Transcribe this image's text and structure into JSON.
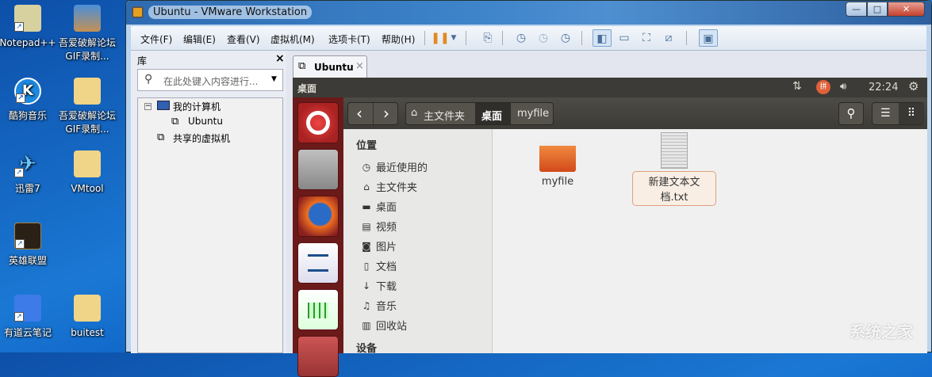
{
  "desktop": {
    "icons": [
      {
        "label": "Notepad++",
        "icon": "notepad-icon"
      },
      {
        "label": "吾爱破解论坛GIF录制...",
        "icon": "archive-icon"
      },
      {
        "label": "酷狗音乐",
        "icon": "kugou-icon"
      },
      {
        "label": "吾爱破解论坛GIF录制...",
        "icon": "folder-icon"
      },
      {
        "label": "迅雷7",
        "icon": "xunlei-icon"
      },
      {
        "label": "VMtool",
        "icon": "folder-icon"
      },
      {
        "label": "英雄联盟",
        "icon": "lol-icon"
      },
      {
        "label": "有道云笔记",
        "icon": "youdao-icon"
      },
      {
        "label": "buitest",
        "icon": "folder-icon"
      }
    ]
  },
  "window": {
    "title": "Ubuntu - VMware Workstation",
    "min": "—",
    "max": "□",
    "close": "✕"
  },
  "menu": [
    "文件(F)",
    "编辑(E)",
    "查看(V)",
    "虚拟机(M)",
    "选项卡(T)",
    "帮助(H)"
  ],
  "library": {
    "title": "库",
    "close": "×",
    "search_placeholder": "在此处键入内容进行...",
    "tree": {
      "root": "我的计算机",
      "child": "Ubuntu",
      "shared": "共享的虚拟机"
    }
  },
  "tab": {
    "label": "Ubuntu",
    "close": "×"
  },
  "ubuntu": {
    "panel_title": "桌面",
    "time": "22:24",
    "breadcrumb": [
      "主文件夹",
      "桌面",
      "myfile"
    ],
    "nav": {
      "back": "‹",
      "forward": "›"
    },
    "sidebar": {
      "places_header": "位置",
      "items": [
        {
          "label": "最近使用的",
          "icon": "clock-icon",
          "glyph": "◷"
        },
        {
          "label": "主文件夹",
          "icon": "home-icon",
          "glyph": "⌂"
        },
        {
          "label": "桌面",
          "icon": "folder-icon",
          "glyph": "▬"
        },
        {
          "label": "视频",
          "icon": "film-icon",
          "glyph": "▤"
        },
        {
          "label": "图片",
          "icon": "camera-icon",
          "glyph": "◙"
        },
        {
          "label": "文档",
          "icon": "document-icon",
          "glyph": "▯"
        },
        {
          "label": "下载",
          "icon": "download-icon",
          "glyph": "↓"
        },
        {
          "label": "音乐",
          "icon": "music-icon",
          "glyph": "♫"
        },
        {
          "label": "回收站",
          "icon": "trash-icon",
          "glyph": "▥"
        }
      ],
      "devices_header": "设备"
    },
    "files": [
      {
        "name": "myfile",
        "type": "folder"
      },
      {
        "name": "新建文本文档.txt",
        "type": "text"
      }
    ]
  },
  "watermark": "系统之家",
  "colors": {
    "accent": "#dd4814",
    "launcher": "#6b1a1a",
    "panel": "#3c3b37"
  }
}
